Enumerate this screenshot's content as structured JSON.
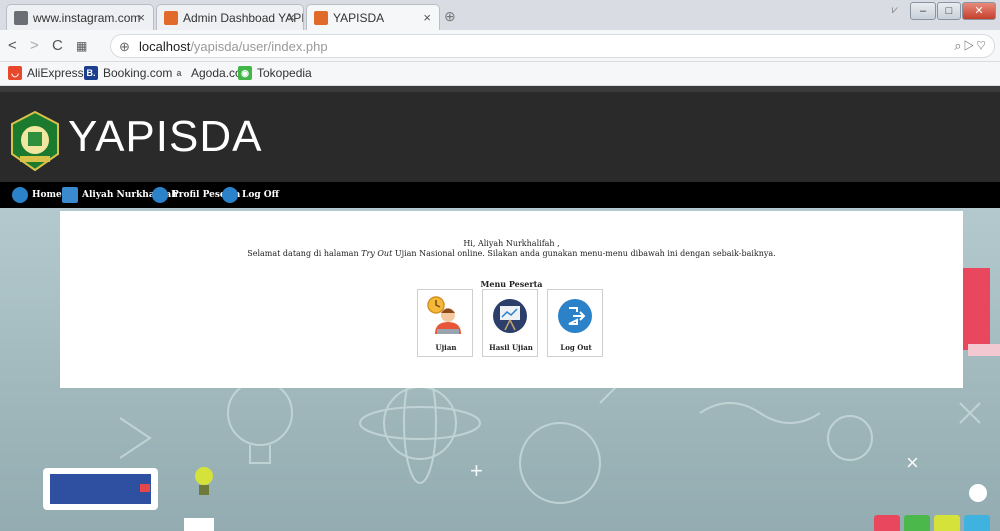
{
  "browser": {
    "tabs": [
      {
        "label": "www.instagram.com",
        "active": false
      },
      {
        "label": "Admin Dashboad YAPISDA",
        "active": false
      },
      {
        "label": "YAPISDA",
        "active": true
      }
    ],
    "url_host": "localhost",
    "url_path": "/yapisda/user/index.php",
    "bookmarks": [
      "AliExpress",
      "Booking.com",
      "Agoda.com",
      "Tokopedia"
    ]
  },
  "site": {
    "title": "YAPISDA",
    "nav": [
      "Home",
      "Aliyah Nurkhalifah",
      "Profil Peserta",
      "Log Off"
    ]
  },
  "main": {
    "greeting_line1": "Hi, Aliyah Nurkhalifah ,",
    "greeting_line2_pre": "Selamat datang di halaman ",
    "greeting_line2_em": "Try Out",
    "greeting_line2_post": " Ujian Nasional online. Silakan anda gunakan menu-menu dibawah ini dengan sebaik-baiknya.",
    "menu_title": "Menu Peserta",
    "menu": [
      {
        "label": "Ujian",
        "icon": "student-clock-icon"
      },
      {
        "label": "Hasil Ujian",
        "icon": "presentation-board-icon"
      },
      {
        "label": "Log Out",
        "icon": "logout-icon"
      }
    ]
  },
  "colors": {
    "header_bg": "#2a2a2a",
    "nav_bg": "#000000",
    "accent_blue": "#2b82c9"
  }
}
